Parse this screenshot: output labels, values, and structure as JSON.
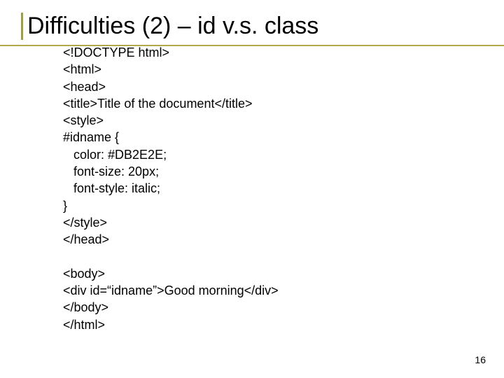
{
  "title": "Difficulties (2) – id v.s. class",
  "code_lines": [
    "<!DOCTYPE html>",
    "<html>",
    "<head>",
    "<title>Title of the document</title>",
    "<style>",
    "#idname {",
    "   color: #DB2E2E;",
    "   font-size: 20px;",
    "   font-style: italic;",
    "}",
    "</style>",
    "</head>",
    "",
    "<body>",
    "<div id=“idname”>Good morning</div>",
    "</body>",
    "</html>"
  ],
  "page_number": "16"
}
